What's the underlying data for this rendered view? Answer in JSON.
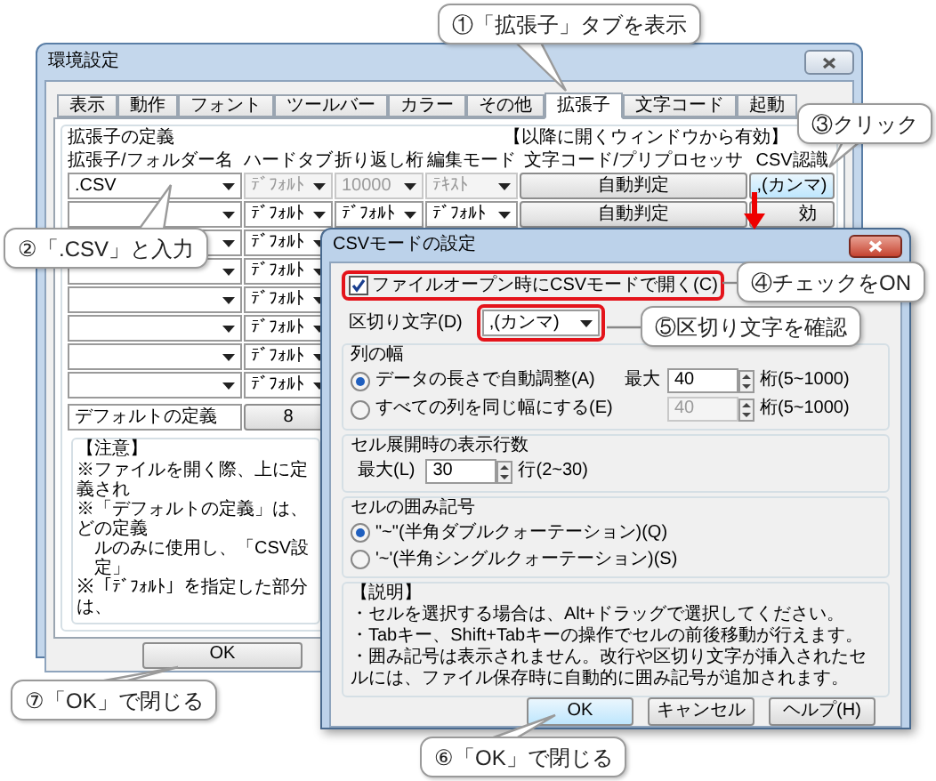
{
  "main_window": {
    "title": "環境設定",
    "tabs": [
      {
        "label": "表示",
        "selected": false
      },
      {
        "label": "動作",
        "selected": false
      },
      {
        "label": "フォント",
        "selected": false
      },
      {
        "label": "ツールバー",
        "selected": false
      },
      {
        "label": "カラー",
        "selected": false
      },
      {
        "label": "その他",
        "selected": false
      },
      {
        "label": "拡張子",
        "selected": true
      },
      {
        "label": "文字コード",
        "selected": false
      },
      {
        "label": "起動",
        "selected": false
      }
    ],
    "group_title": "拡張子の定義",
    "notice": "【以降に開くウィンドウから有効】",
    "columns": [
      "拡張子/フォルダー名",
      "ハードタブ",
      "折り返し桁",
      "編集モード",
      "文字コード/プリプロセッサ",
      "CSV認識"
    ],
    "rows": [
      {
        "name": ".CSV",
        "hard_tab": "ﾃﾞﾌｫﾙﾄ",
        "wrap": "10000",
        "edit_mode": "ﾃｷｽﾄ",
        "encoding": "自動判定",
        "csv": ",(カンマ)",
        "disabled": true
      },
      {
        "hard_tab": "ﾃﾞﾌｫﾙﾄ",
        "wrap": "ﾃﾞﾌｫﾙﾄ",
        "edit_mode": "ﾃﾞﾌｫﾙﾄ",
        "encoding": "自動判定",
        "csv": "効",
        "disabled": false
      },
      {
        "hard_tab": "ﾃﾞﾌｫﾙﾄ",
        "disabled": false
      },
      {
        "hard_tab": "ﾃﾞﾌｫﾙﾄ",
        "disabled": false
      },
      {
        "hard_tab": "ﾃﾞﾌｫﾙﾄ",
        "disabled": false
      },
      {
        "hard_tab": "ﾃﾞﾌｫﾙﾄ",
        "disabled": false
      },
      {
        "hard_tab": "ﾃﾞﾌｫﾙﾄ",
        "disabled": false
      },
      {
        "hard_tab": "ﾃﾞﾌｫﾙﾄ",
        "disabled": false
      }
    ],
    "default_row": {
      "label": "デフォルトの定義",
      "value": "8"
    },
    "notes_title": "【注意】",
    "notes": [
      {
        "kind": "item",
        "text": "※ファイルを開く際、上に定義され"
      },
      {
        "kind": "item",
        "text": "※「デフォルトの定義」は、どの定義"
      },
      {
        "kind": "continuation",
        "text": "ルのみに使用し、「CSV設定」"
      },
      {
        "kind": "item",
        "text": "※「ﾃﾞﾌｫﾙﾄ」を指定した部分は、"
      }
    ],
    "ok_button": "OK"
  },
  "dialog": {
    "title": "CSVモードの設定",
    "open_in_csv": {
      "label": "ファイルオープン時にCSVモードで開く(C)",
      "checked": true
    },
    "delimiter": {
      "label": "区切り文字(D)",
      "value": ",(カンマ)"
    },
    "column_width": {
      "title": "列の幅",
      "options": [
        {
          "label": "データの長さで自動調整(A)",
          "selected": true,
          "max_label": "最大",
          "value": "40",
          "range": "桁(5~1000)",
          "disabled": false
        },
        {
          "label": "すべての列を同じ幅にする(E)",
          "selected": false,
          "value": "40",
          "range": "桁(5~1000)",
          "disabled": true
        }
      ]
    },
    "rows_on_expand": {
      "title": "セル展開時の表示行数",
      "label": "最大(L)",
      "value": "30",
      "range": "行(2~30)"
    },
    "quote_mark": {
      "title": "セルの囲み記号",
      "options": [
        {
          "label": "\"~\"(半角ダブルクォーテーション)(Q)",
          "selected": true
        },
        {
          "label": "'~'(半角シングルクォーテーション)(S)",
          "selected": false
        }
      ]
    },
    "description": {
      "title": "【説明】",
      "bullets": [
        "・セルを選択する場合は、Alt+ドラッグで選択してください。",
        "・Tabキー、Shift+Tabキーの操作でセルの前後移動が行えます。",
        "・囲み記号は表示されません。改行や区切り文字が挿入されたセルには、ファイル保存時に自動的に囲み記号が追加されます。"
      ]
    },
    "buttons": [
      {
        "label": "OK",
        "default": true
      },
      {
        "label": "キャンセル",
        "default": false
      },
      {
        "label": "ヘルプ(H)",
        "default": false
      }
    ]
  },
  "callouts": [
    {
      "text": "①「拡張子」タブを表示"
    },
    {
      "text": "②「.CSV」と入力"
    },
    {
      "text": "③クリック"
    },
    {
      "text": "④チェックをON"
    },
    {
      "text": "⑤区切り文字を確認"
    },
    {
      "text": "⑥「OK」で閉じる"
    },
    {
      "text": "⑦「OK」で閉じる"
    }
  ]
}
